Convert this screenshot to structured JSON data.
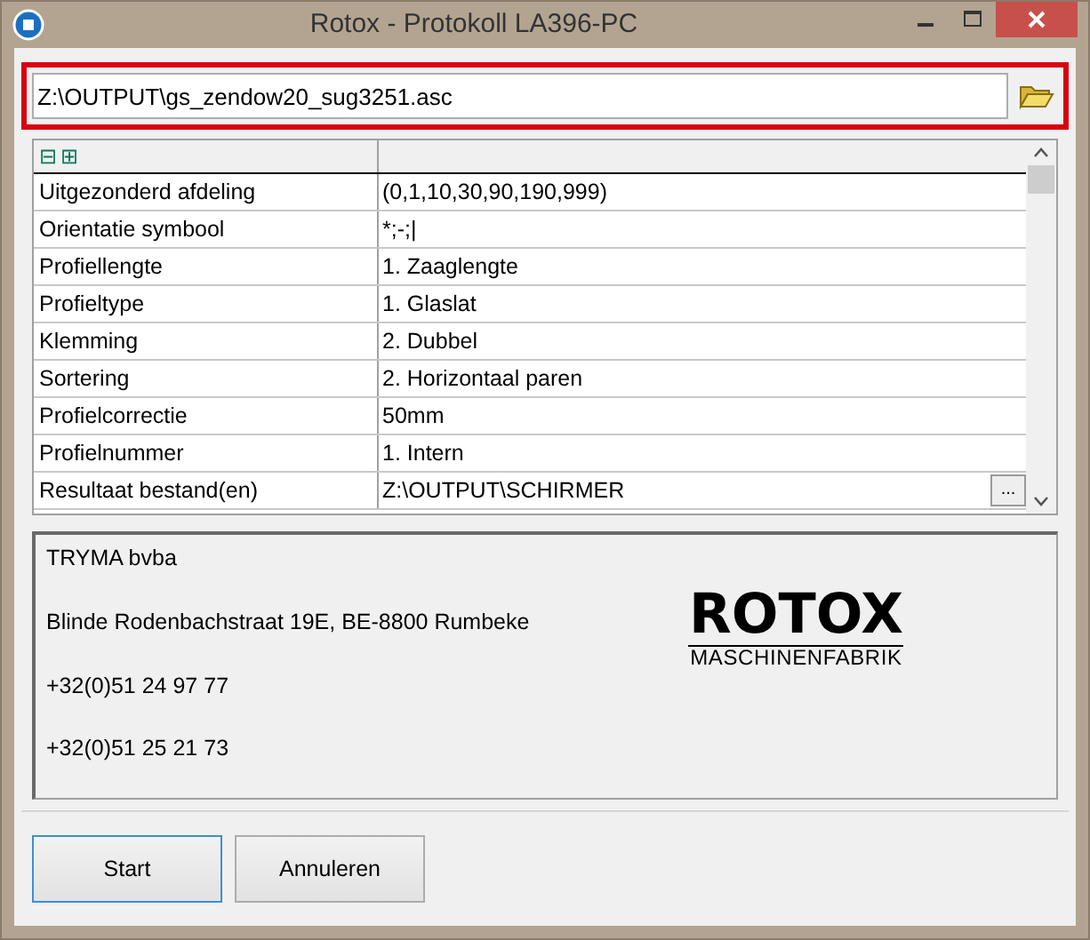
{
  "window": {
    "title": "Rotox - Protokoll LA396-PC"
  },
  "file_field": {
    "value": "Z:\\OUTPUT\\gs_zendow20_sug3251.asc",
    "highlighted": true
  },
  "grid": {
    "header_icons": [
      "⊟",
      "⊞"
    ],
    "rows": [
      {
        "label": "Uitgezonderd afdeling",
        "value": "(0,1,10,30,90,190,999)"
      },
      {
        "label": "Orientatie symbool",
        "value": "*;-;|"
      },
      {
        "label": "Profiellengte",
        "value": "1. Zaaglengte"
      },
      {
        "label": "Profieltype",
        "value": "1. Glaslat"
      },
      {
        "label": "Klemming",
        "value": "2. Dubbel"
      },
      {
        "label": "Sortering",
        "value": "2. Horizontaal paren"
      },
      {
        "label": "Profielcorrectie",
        "value": "50mm"
      },
      {
        "label": "Profielnummer",
        "value": "1. Intern"
      },
      {
        "label": "Resultaat bestand(en)",
        "value": "Z:\\OUTPUT\\SCHIRMER",
        "browse_label": "..."
      }
    ]
  },
  "info": {
    "lines": [
      "TRYMA bvba",
      "Blinde Rodenbachstraat 19E, BE-8800 Rumbeke",
      "+32(0)51 24 97 77",
      "+32(0)51 25 21 73"
    ],
    "logo": {
      "name": "ROTOX",
      "subtitle": "MASCHINENFABRIK"
    }
  },
  "buttons": [
    {
      "label": "Start",
      "default": true
    },
    {
      "label": "Annuleren",
      "default": false
    }
  ]
}
